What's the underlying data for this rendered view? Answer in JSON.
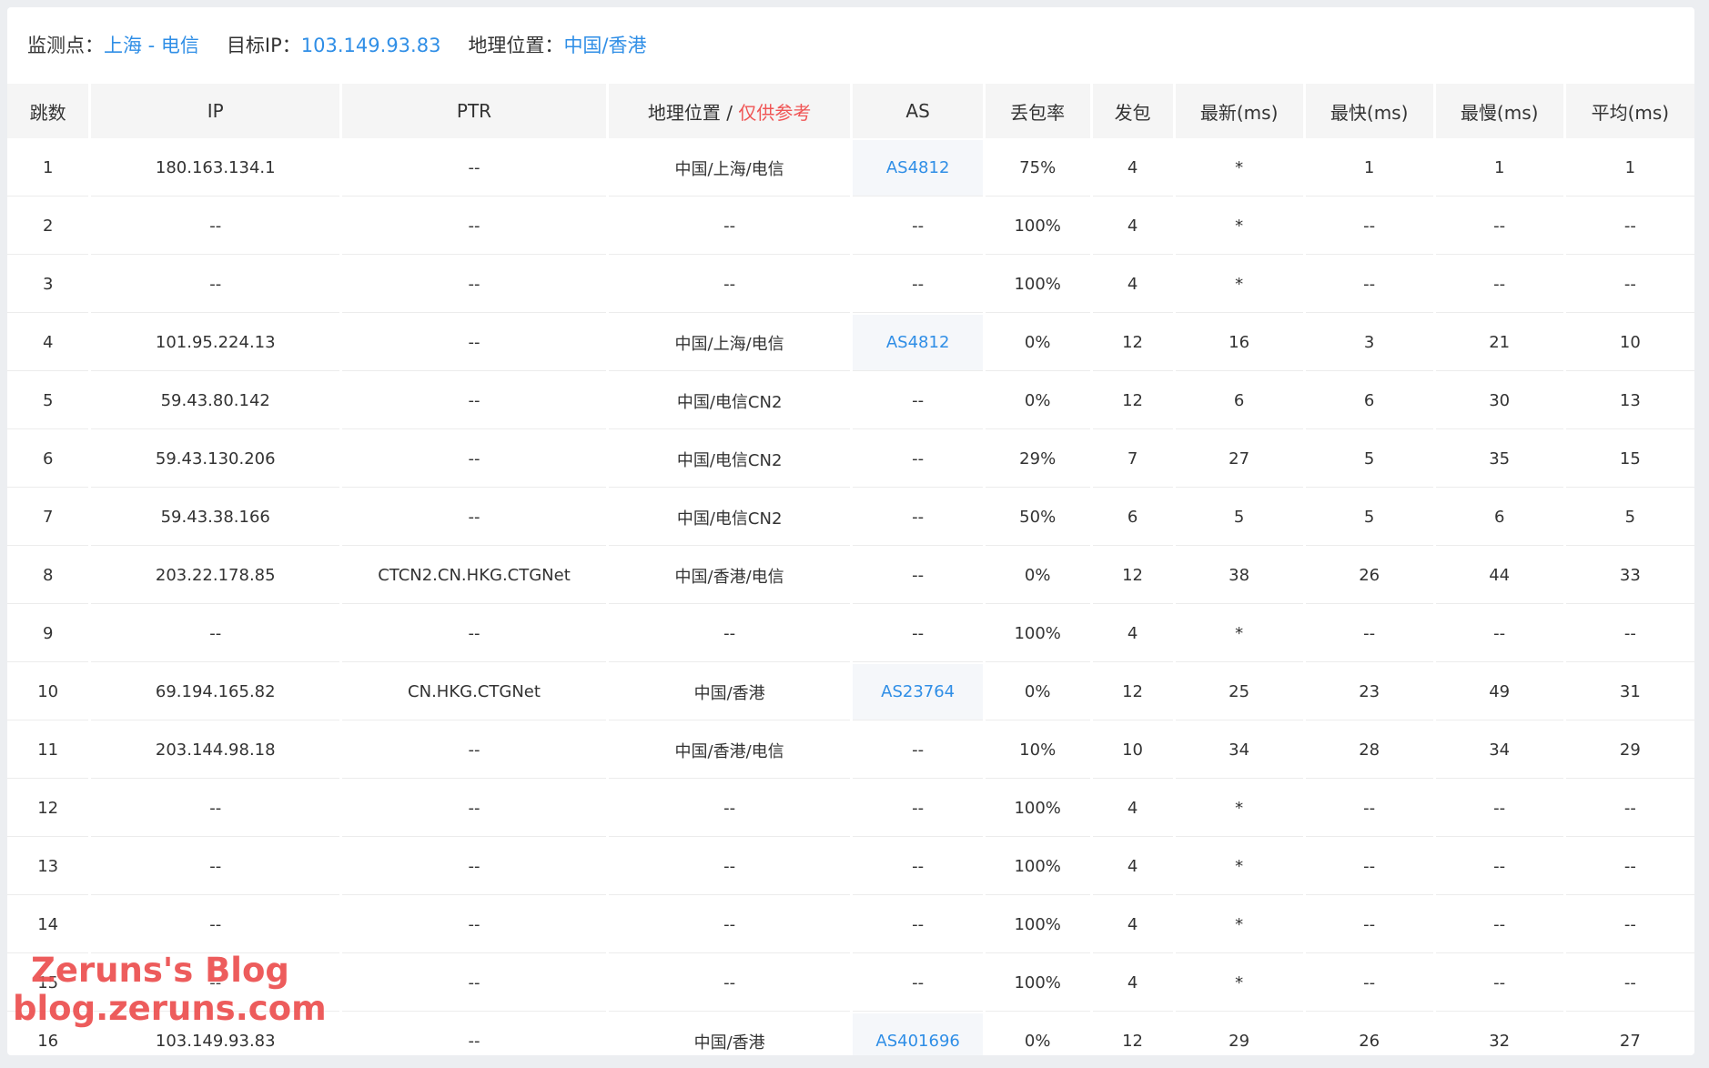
{
  "info": {
    "monitor_label": "监测点：",
    "monitor_value": "上海 - 电信",
    "target_label": "目标IP：",
    "target_value": "103.149.93.83",
    "geo_label": "地理位置：",
    "geo_value": "中国/香港"
  },
  "columns": {
    "hop": "跳数",
    "ip": "IP",
    "ptr": "PTR",
    "geo": "地理位置",
    "geo_sep": " / ",
    "geo_note": "仅供参考",
    "as": "AS",
    "loss": "丢包率",
    "sent": "发包",
    "last": "最新(ms)",
    "best": "最快(ms)",
    "worst": "最慢(ms)",
    "avg": "平均(ms)"
  },
  "rows": [
    {
      "hop": "1",
      "ip": "180.163.134.1",
      "ptr": "--",
      "geo": "中国/上海/电信",
      "as": "AS4812",
      "loss": "75%",
      "sent": "4",
      "last": "*",
      "best": "1",
      "worst": "1",
      "avg": "1"
    },
    {
      "hop": "2",
      "ip": "--",
      "ptr": "--",
      "geo": "--",
      "as": "--",
      "loss": "100%",
      "sent": "4",
      "last": "*",
      "best": "--",
      "worst": "--",
      "avg": "--"
    },
    {
      "hop": "3",
      "ip": "--",
      "ptr": "--",
      "geo": "--",
      "as": "--",
      "loss": "100%",
      "sent": "4",
      "last": "*",
      "best": "--",
      "worst": "--",
      "avg": "--"
    },
    {
      "hop": "4",
      "ip": "101.95.224.13",
      "ptr": "--",
      "geo": "中国/上海/电信",
      "as": "AS4812",
      "loss": "0%",
      "sent": "12",
      "last": "16",
      "best": "3",
      "worst": "21",
      "avg": "10"
    },
    {
      "hop": "5",
      "ip": "59.43.80.142",
      "ptr": "--",
      "geo": "中国/电信CN2",
      "as": "--",
      "loss": "0%",
      "sent": "12",
      "last": "6",
      "best": "6",
      "worst": "30",
      "avg": "13"
    },
    {
      "hop": "6",
      "ip": "59.43.130.206",
      "ptr": "--",
      "geo": "中国/电信CN2",
      "as": "--",
      "loss": "29%",
      "sent": "7",
      "last": "27",
      "best": "5",
      "worst": "35",
      "avg": "15"
    },
    {
      "hop": "7",
      "ip": "59.43.38.166",
      "ptr": "--",
      "geo": "中国/电信CN2",
      "as": "--",
      "loss": "50%",
      "sent": "6",
      "last": "5",
      "best": "5",
      "worst": "6",
      "avg": "5"
    },
    {
      "hop": "8",
      "ip": "203.22.178.85",
      "ptr": "CTCN2.CN.HKG.CTGNet",
      "geo": "中国/香港/电信",
      "as": "--",
      "loss": "0%",
      "sent": "12",
      "last": "38",
      "best": "26",
      "worst": "44",
      "avg": "33"
    },
    {
      "hop": "9",
      "ip": "--",
      "ptr": "--",
      "geo": "--",
      "as": "--",
      "loss": "100%",
      "sent": "4",
      "last": "*",
      "best": "--",
      "worst": "--",
      "avg": "--"
    },
    {
      "hop": "10",
      "ip": "69.194.165.82",
      "ptr": "CN.HKG.CTGNet",
      "geo": "中国/香港",
      "as": "AS23764",
      "loss": "0%",
      "sent": "12",
      "last": "25",
      "best": "23",
      "worst": "49",
      "avg": "31"
    },
    {
      "hop": "11",
      "ip": "203.144.98.18",
      "ptr": "--",
      "geo": "中国/香港/电信",
      "as": "--",
      "loss": "10%",
      "sent": "10",
      "last": "34",
      "best": "28",
      "worst": "34",
      "avg": "29"
    },
    {
      "hop": "12",
      "ip": "--",
      "ptr": "--",
      "geo": "--",
      "as": "--",
      "loss": "100%",
      "sent": "4",
      "last": "*",
      "best": "--",
      "worst": "--",
      "avg": "--"
    },
    {
      "hop": "13",
      "ip": "--",
      "ptr": "--",
      "geo": "--",
      "as": "--",
      "loss": "100%",
      "sent": "4",
      "last": "*",
      "best": "--",
      "worst": "--",
      "avg": "--"
    },
    {
      "hop": "14",
      "ip": "--",
      "ptr": "--",
      "geo": "--",
      "as": "--",
      "loss": "100%",
      "sent": "4",
      "last": "*",
      "best": "--",
      "worst": "--",
      "avg": "--"
    },
    {
      "hop": "15",
      "ip": "--",
      "ptr": "--",
      "geo": "--",
      "as": "--",
      "loss": "100%",
      "sent": "4",
      "last": "*",
      "best": "--",
      "worst": "--",
      "avg": "--"
    },
    {
      "hop": "16",
      "ip": "103.149.93.83",
      "ptr": "--",
      "geo": "中国/香港",
      "as": "AS401696",
      "loss": "0%",
      "sent": "12",
      "last": "29",
      "best": "26",
      "worst": "32",
      "avg": "27"
    }
  ],
  "watermark": {
    "line1": "Zeruns's Blog",
    "line2": "blog.zeruns.com"
  },
  "colors": {
    "link": "#2f8ee6",
    "note": "#f05555",
    "header_bg": "#f5f5f5",
    "watermark": "#eb4646"
  }
}
